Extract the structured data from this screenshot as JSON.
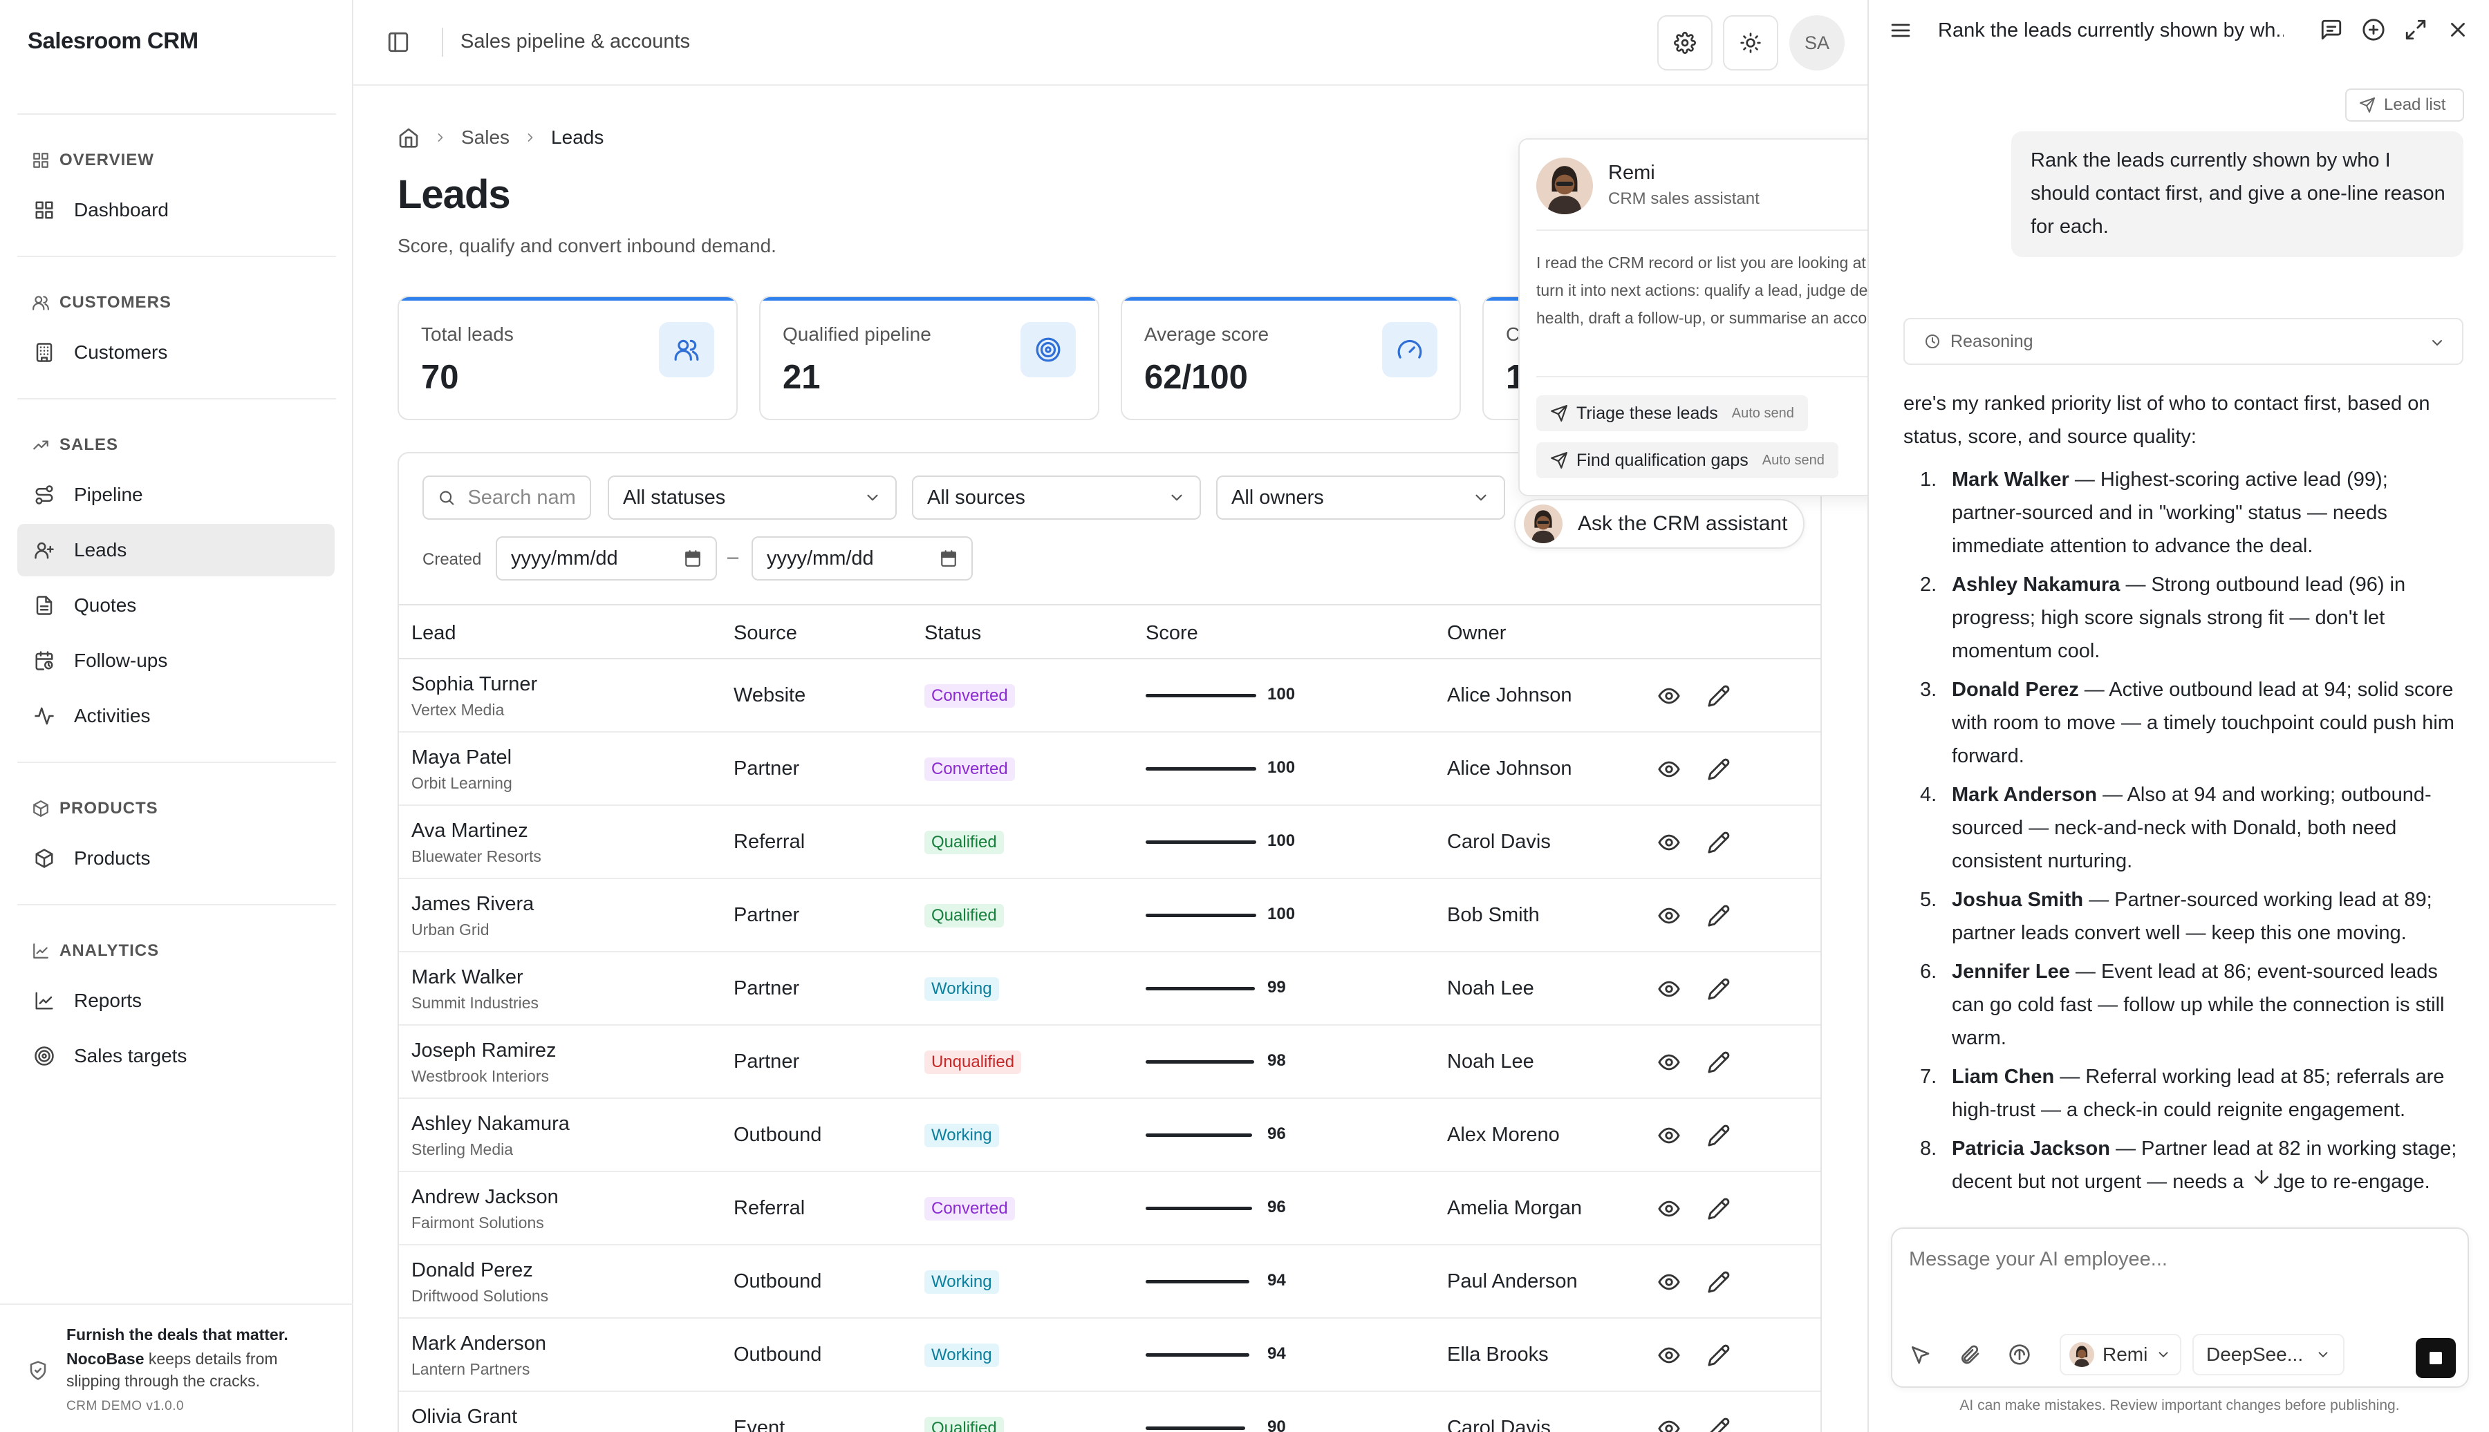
{
  "app": {
    "name": "Salesroom CRM"
  },
  "sidebar": {
    "groups": [
      {
        "label": "OVERVIEW",
        "items": [
          {
            "label": "Dashboard",
            "icon": "grid-icon"
          }
        ]
      },
      {
        "label": "CUSTOMERS",
        "items": [
          {
            "label": "Customers",
            "icon": "building-icon"
          }
        ]
      },
      {
        "label": "SALES",
        "items": [
          {
            "label": "Pipeline",
            "icon": "route-icon"
          },
          {
            "label": "Leads",
            "icon": "user-plus-icon",
            "active": true
          },
          {
            "label": "Quotes",
            "icon": "file-icon"
          },
          {
            "label": "Follow-ups",
            "icon": "calendar-clock-icon"
          },
          {
            "label": "Activities",
            "icon": "activity-icon"
          }
        ]
      },
      {
        "label": "PRODUCTS",
        "items": [
          {
            "label": "Products",
            "icon": "package-icon"
          }
        ]
      },
      {
        "label": "ANALYTICS",
        "items": [
          {
            "label": "Reports",
            "icon": "chart-icon"
          },
          {
            "label": "Sales targets",
            "icon": "target-icon"
          }
        ]
      }
    ],
    "footer": {
      "title": "Furnish the deals that matter.",
      "brand": "NocoBase",
      "text": " keeps details from slipping through the cracks.",
      "version": "CRM DEMO v1.0.0"
    }
  },
  "topbar": {
    "title": "Sales pipeline & accounts",
    "avatar": "SA"
  },
  "breadcrumb": [
    "Sales",
    "Leads"
  ],
  "page": {
    "title": "Leads",
    "subtitle": "Score, qualify and convert inbound demand."
  },
  "stats": [
    {
      "label": "Total leads",
      "value": "70",
      "icon": "users-icon"
    },
    {
      "label": "Qualified pipeline",
      "value": "21",
      "icon": "target-icon"
    },
    {
      "label": "Average score",
      "value": "62/100",
      "icon": "gauge-icon"
    },
    {
      "label": "C",
      "value": "1",
      "icon": "none"
    }
  ],
  "filters": {
    "search_placeholder": "Search name",
    "status": "All statuses",
    "source": "All sources",
    "owner": "All owners",
    "created_label": "Created",
    "date_from": "yyyy/mm/dd",
    "date_to": "yyyy/mm/dd",
    "date_sep": "–"
  },
  "table": {
    "columns": [
      "Lead",
      "Source",
      "Status",
      "Score",
      "Owner"
    ],
    "rows": [
      {
        "name": "Sophia Turner",
        "company": "Vertex Media",
        "source": "Website",
        "status": "Converted",
        "score": 100,
        "owner": "Alice Johnson"
      },
      {
        "name": "Maya Patel",
        "company": "Orbit Learning",
        "source": "Partner",
        "status": "Converted",
        "score": 100,
        "owner": "Alice Johnson"
      },
      {
        "name": "Ava Martinez",
        "company": "Bluewater Resorts",
        "source": "Referral",
        "status": "Qualified",
        "score": 100,
        "owner": "Carol Davis"
      },
      {
        "name": "James Rivera",
        "company": "Urban Grid",
        "source": "Partner",
        "status": "Qualified",
        "score": 100,
        "owner": "Bob Smith"
      },
      {
        "name": "Mark Walker",
        "company": "Summit Industries",
        "source": "Partner",
        "status": "Working",
        "score": 99,
        "owner": "Noah Lee"
      },
      {
        "name": "Joseph Ramirez",
        "company": "Westbrook Interiors",
        "source": "Partner",
        "status": "Unqualified",
        "score": 98,
        "owner": "Noah Lee"
      },
      {
        "name": "Ashley Nakamura",
        "company": "Sterling Media",
        "source": "Outbound",
        "status": "Working",
        "score": 96,
        "owner": "Alex Moreno"
      },
      {
        "name": "Andrew Jackson",
        "company": "Fairmont Solutions",
        "source": "Referral",
        "status": "Converted",
        "score": 96,
        "owner": "Amelia Morgan"
      },
      {
        "name": "Donald Perez",
        "company": "Driftwood Solutions",
        "source": "Outbound",
        "status": "Working",
        "score": 94,
        "owner": "Paul Anderson"
      },
      {
        "name": "Mark Anderson",
        "company": "Lantern Partners",
        "source": "Outbound",
        "status": "Working",
        "score": 94,
        "owner": "Ella Brooks"
      },
      {
        "name": "Olivia Grant",
        "company": "",
        "source": "Event",
        "status": "Qualified",
        "score": 90,
        "owner": "Carol Davis"
      }
    ]
  },
  "assistant_popover": {
    "name": "Remi",
    "role": "CRM sales assistant",
    "description": "I read the CRM record or list you are looking at and turn it into next actions: qualify a lead, judge deal health, draft a follow-up, or summarise an account.",
    "actions": [
      {
        "label": "Triage these leads",
        "tag": "Auto send"
      },
      {
        "label": "Find qualification gaps",
        "tag": "Auto send"
      }
    ],
    "ask_button": "Ask the CRM assistant"
  },
  "chat": {
    "title": "Rank the leads currently shown by wh...",
    "context_chip": "Lead list",
    "user_message": "Rank the leads currently shown by who I should contact first, and give a one-line reason for each.",
    "reasoning_label": "Reasoning",
    "intro": "ere's my ranked priority list of who to contact first, based on status, score, and source quality:",
    "items": [
      {
        "num": "1.",
        "name": "Mark Walker",
        "text": " — Highest-scoring active lead (99); partner-sourced and in \"working\" status — needs immediate attention to advance the deal."
      },
      {
        "num": "2.",
        "name": "Ashley Nakamura",
        "text": " — Strong outbound lead (96) in progress; high score signals strong fit — don't let momentum cool."
      },
      {
        "num": "3.",
        "name": "Donald Perez",
        "text": " — Active outbound lead at 94; solid score with room to move — a timely touchpoint could push him forward."
      },
      {
        "num": "4.",
        "name": "Mark Anderson",
        "text": " — Also at 94 and working; outbound-sourced — neck-and-neck with Donald, both need consistent nurturing."
      },
      {
        "num": "5.",
        "name": "Joshua Smith",
        "text": " — Partner-sourced working lead at 89; partner leads convert well — keep this one moving."
      },
      {
        "num": "6.",
        "name": "Jennifer Lee",
        "text": " — Event lead at 86; event-sourced leads can go cold fast — follow up while the connection is still warm."
      },
      {
        "num": "7.",
        "name": "Liam Chen",
        "text": " — Referral working lead at 85; referrals are high-trust — a check-in could reignite engagement."
      },
      {
        "num": "8.",
        "name": "Patricia Jackson",
        "text": " — Partner lead at 82 in working stage; decent but not urgent — needs a nudge to re-engage."
      }
    ],
    "composer_placeholder": "Message your AI employee...",
    "agent": "Remi",
    "model": "DeepSee...",
    "disclaimer": "AI can make mistakes. Review important changes before publishing."
  },
  "colors": {
    "accent": "#2f80ed",
    "converted": "#8a2bd0",
    "qualified": "#16803c",
    "working": "#0c7e9c",
    "unqualified": "#c62828"
  }
}
